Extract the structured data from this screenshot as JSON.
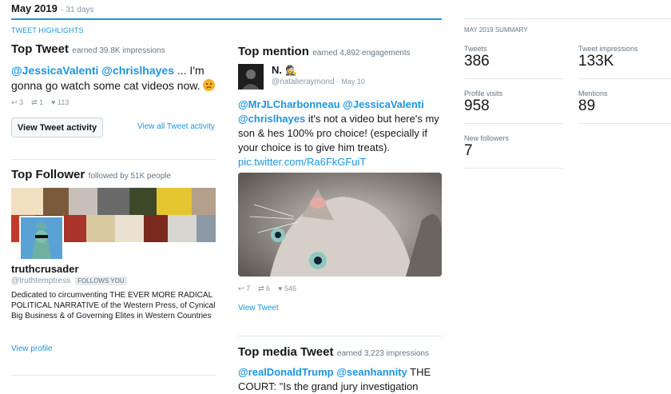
{
  "header": {
    "month": "May 2019",
    "days": "31 days"
  },
  "highlights": {
    "heading": "TWEET HIGHLIGHTS",
    "top_tweet": {
      "title": "Top Tweet",
      "subtitle": "earned 39.8K impressions",
      "mention1": "@JessicaValenti",
      "mention2": "@chrislhayes",
      "text_rest": " ... I'm gonna go watch some cat videos now.",
      "emoji": "disappointed-face-emoji",
      "replies": "3",
      "retweets": "1",
      "likes": "113",
      "activity_button": "View Tweet activity",
      "all_activity_link": "View all Tweet activity"
    },
    "top_follower": {
      "title": "Top Follower",
      "subtitle": "followed by 51K people",
      "name": "truthcrusader",
      "handle": "@truthtemptress",
      "follows_badge": "FOLLOWS YOU",
      "bio": "Dedicated to circumventing THE EVER MORE RADICAL POLITICAL NARRATIVE of the Western Press, of Cynical Big Business & of Governing Elites in Western Countries",
      "view_profile": "View profile"
    },
    "top_mention": {
      "title": "Top mention",
      "subtitle": "earned 4,892 engagements",
      "name": "N.",
      "name_emoji": "detective-emoji",
      "handle": "@natalieraymond",
      "date": "May 10",
      "mention1": "@MrJLCharbonneau",
      "mention2": "@JessicaValenti",
      "mention3": "@chrislhayes",
      "text_rest": " it's not a video but here's my son & hes 100% pro choice! (especially if your choice is to give him treats).",
      "pic_link": "pic.twitter.com/Ra6FkGFuiT",
      "replies": "7",
      "retweets": "6",
      "likes": "546",
      "view_tweet": "View Tweet"
    },
    "top_media": {
      "title": "Top media Tweet",
      "subtitle": "earned 3,223 impressions",
      "mention1": "@realDonaldTrump",
      "mention2": "@seanhannity",
      "text_rest": " THE COURT: \"Is the grand jury investigation"
    }
  },
  "summary": {
    "heading": "MAY 2019 SUMMARY",
    "tweets_label": "Tweets",
    "tweets_value": "386",
    "impressions_label": "Tweet impressions",
    "impressions_value": "133K",
    "profile_visits_label": "Profile visits",
    "profile_visits_value": "958",
    "mentions_label": "Mentions",
    "mentions_value": "89",
    "new_followers_label": "New followers",
    "new_followers_value": "7"
  },
  "colors": {
    "accent": "#1b95e0",
    "divider": "#e1e8ed",
    "muted": "#8899a6"
  }
}
